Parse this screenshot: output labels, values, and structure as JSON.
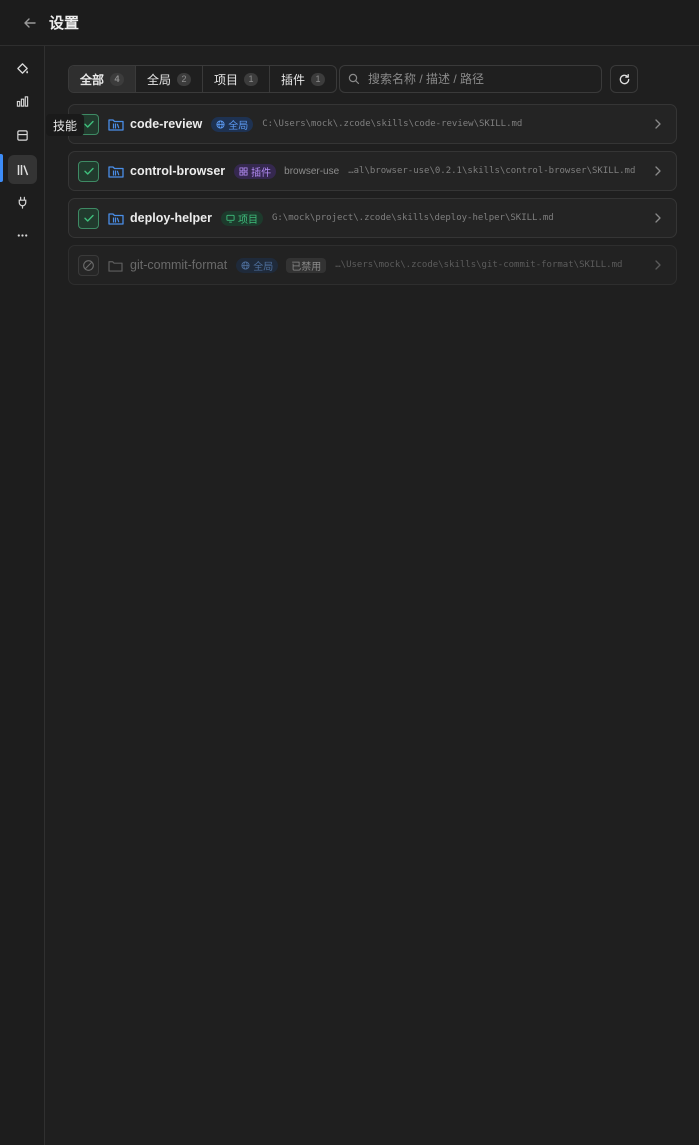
{
  "header": {
    "title": "设置"
  },
  "sidebar": {
    "tooltip": "技能",
    "items": [
      {
        "icon": "paint-bucket-icon"
      },
      {
        "icon": "bar-chart-icon"
      },
      {
        "icon": "database-icon"
      },
      {
        "icon": "library-icon",
        "active": true
      },
      {
        "icon": "plug-icon"
      },
      {
        "icon": "more-icon"
      }
    ]
  },
  "filters": {
    "tabs": [
      {
        "label": "全部",
        "count": "4",
        "active": true
      },
      {
        "label": "全局",
        "count": "2"
      },
      {
        "label": "项目",
        "count": "1"
      },
      {
        "label": "插件",
        "count": "1"
      }
    ],
    "search_placeholder": "搜索名称 / 描述 / 路径"
  },
  "skills": [
    {
      "name": "code-review",
      "scope": "全局",
      "scope_type": "global",
      "path": "C:\\Users\\mock\\.zcode\\skills\\code-review\\SKILL.md",
      "enabled": true
    },
    {
      "name": "control-browser",
      "scope": "插件",
      "scope_type": "plugin",
      "plugin": "browser-use",
      "path": "…al\\browser-use\\0.2.1\\skills\\control-browser\\SKILL.md",
      "enabled": true
    },
    {
      "name": "deploy-helper",
      "scope": "项目",
      "scope_type": "project",
      "path": "G:\\mock\\project\\.zcode\\skills\\deploy-helper\\SKILL.md",
      "enabled": true
    },
    {
      "name": "git-commit-format",
      "scope": "全局",
      "scope_type": "global",
      "status": "已禁用",
      "path": "…\\Users\\mock\\.zcode\\skills\\git-commit-format\\SKILL.md",
      "enabled": false
    }
  ],
  "colors": {
    "accent": "#3d8cf7",
    "enabled_check": "#3fbe7c",
    "global_badge": "#5d9cf5",
    "plugin_badge": "#b18af2",
    "project_badge": "#3fbe7c"
  }
}
